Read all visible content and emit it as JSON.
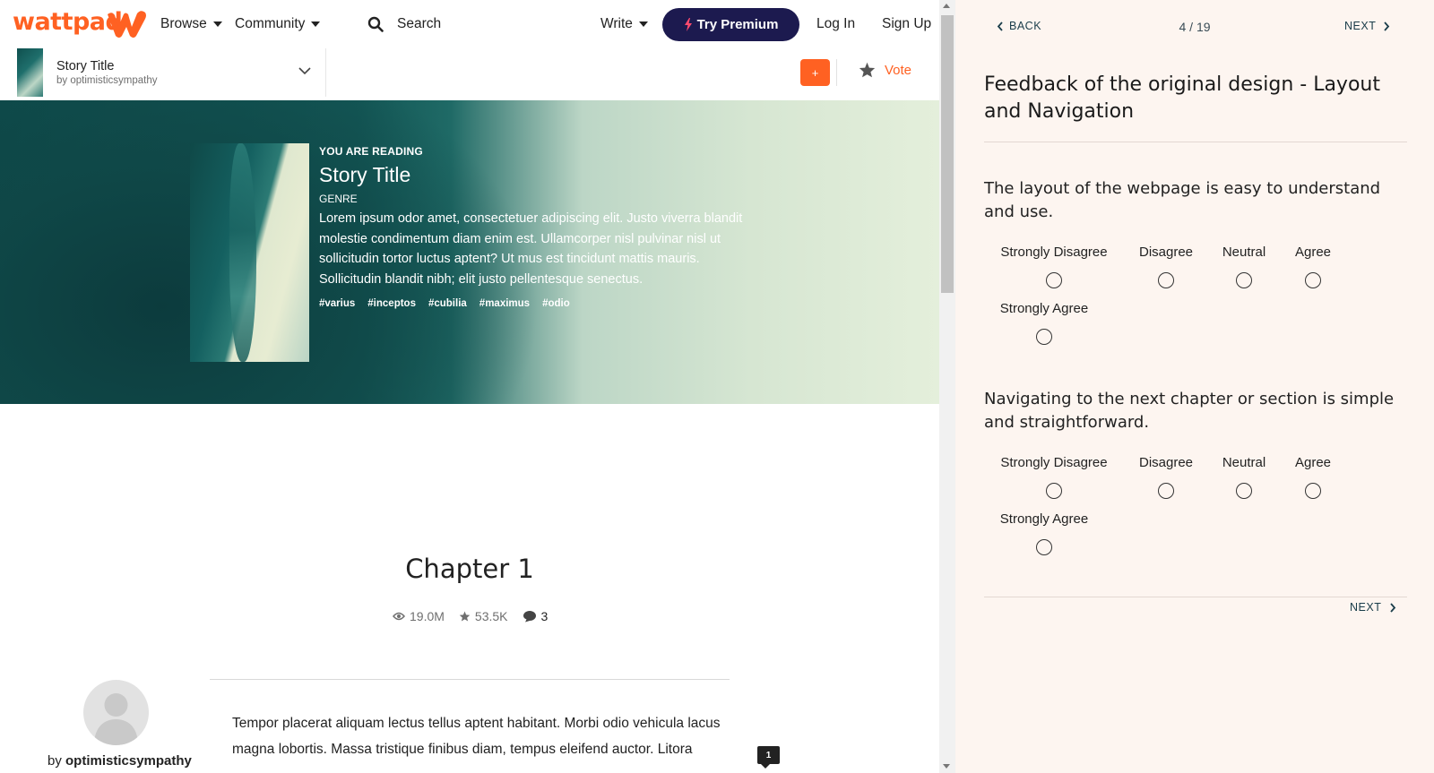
{
  "nav": {
    "logo": "wattpad",
    "browse": "Browse",
    "community": "Community",
    "search": "Search",
    "write": "Write",
    "premium": "Try Premium",
    "login": "Log In",
    "signup": "Sign Up"
  },
  "storybar": {
    "title": "Story Title",
    "author": "by optimisticsympathy",
    "add_label": "+",
    "vote_label": "Vote"
  },
  "hero": {
    "reading_label": "YOU ARE READING",
    "title": "Story Title",
    "genre": "GENRE",
    "description": "Lorem ipsum odor amet, consectetuer adipiscing elit. Justo viverra blandit molestie condimentum diam enim est. Ullamcorper nisl pulvinar nisl ut sollicitudin tortor luctus aptent? Ut mus est tincidunt mattis mauris. Sollicitudin blandit nibh; elit justo pellentesque senectus.",
    "tags": [
      "#varius",
      "#inceptos",
      "#cubilia",
      "#maximus",
      "#odio"
    ]
  },
  "chapter": {
    "title": "Chapter 1",
    "reads": "19.0M",
    "votes": "53.5K",
    "comments": "3",
    "author_prefix": "by",
    "author": "optimisticsympathy",
    "body": "Tempor placerat aliquam lectus tellus aptent habitant. Morbi odio vehicula lacus magna lobortis. Massa tristique finibus diam, tempus eleifend auctor. Litora",
    "inline_comment_count": "1"
  },
  "survey": {
    "back": "BACK",
    "progress": "4 / 19",
    "next": "NEXT",
    "heading": "Feedback of the original design - Layout and Navigation",
    "questions": [
      {
        "text": "The layout of the webpage is easy to understand and use.",
        "options": [
          "Strongly Disagree",
          "Disagree",
          "Neutral",
          "Agree",
          "Strongly Agree"
        ]
      },
      {
        "text": "Navigating to the next chapter or section is simple and straightforward.",
        "options": [
          "Strongly Disagree",
          "Disagree",
          "Neutral",
          "Agree",
          "Strongly Agree"
        ]
      }
    ],
    "next_bottom": "NEXT"
  },
  "colors": {
    "brand_orange": "#ff6122",
    "premium_navy": "#1c1a4f",
    "survey_bg": "#fdf5f0"
  }
}
